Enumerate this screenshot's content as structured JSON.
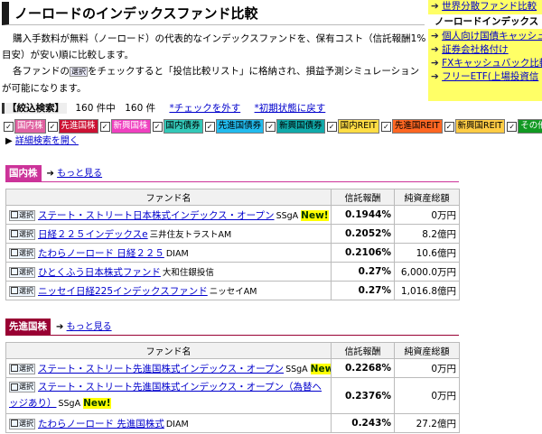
{
  "page": {
    "title": "ノーロードのインデックスファンド比較",
    "intro_line1": "購入手数料が無料（ノーロード）の代表的なインデックスファンドを、保有コスト（信託報酬1%目安）が安い順に比較します。",
    "intro_line2a": "各ファンドの",
    "intro_chk": "選択",
    "intro_line2b": "をチェックすると「投信比較リスト」に格納され、損益予測シミュレーションが可能になります。"
  },
  "sidebar": {
    "items": [
      {
        "label": "世界分散ファンド比較"
      },
      {
        "label": "ノーロードインデックス"
      },
      {
        "label": "個人向け国債キャッシュ"
      },
      {
        "label": "証券会社格付け"
      },
      {
        "label": "FXキャッシュバック比較"
      },
      {
        "label": "フリーETF(上場投資信"
      }
    ]
  },
  "filter": {
    "label": "【絞込検索】",
    "count": "160 件中　160 件",
    "uncheck": "*チェックを外す",
    "reset": "*初期状態に戻す",
    "detail": "詳細検索を開く",
    "tags": [
      {
        "label": "国内株",
        "bg": "#e060a0",
        "fg": "#ffffff"
      },
      {
        "label": "先進国株",
        "bg": "#cc1133",
        "fg": "#ffffff"
      },
      {
        "label": "新興国株",
        "bg": "#f040c0",
        "fg": "#ffffff"
      },
      {
        "label": "国内債券",
        "bg": "#33c8b8",
        "fg": "#000000"
      },
      {
        "label": "先進国債券",
        "bg": "#22bbee",
        "fg": "#000000"
      },
      {
        "label": "新興国債券",
        "bg": "#11aaaa",
        "fg": "#000000"
      },
      {
        "label": "国内REIT",
        "bg": "#ffdd44",
        "fg": "#000000"
      },
      {
        "label": "先進国REIT",
        "bg": "#ff6622",
        "fg": "#000000"
      },
      {
        "label": "新興国REIT",
        "bg": "#ffcc44",
        "fg": "#000000"
      },
      {
        "label": "その他",
        "bg": "#119922",
        "fg": "#ffffff"
      }
    ]
  },
  "table_headers": {
    "name": "ファンド名",
    "fee": "信託報酬",
    "net": "純資産総額"
  },
  "select_label": "選択",
  "new_label": "New!",
  "sections": [
    {
      "title": "国内株",
      "color": "#cc3399",
      "more": "もっと見る",
      "rows": [
        {
          "name": "ステート・ストリート日本株式インデックス・オープン",
          "company": "SSgA",
          "new": true,
          "fee": "0.1944%",
          "net": "0万円"
        },
        {
          "name": "日経２２５インデックスe",
          "company": "三井住友トラストAM",
          "new": false,
          "fee": "0.2052%",
          "net": "8.2億円"
        },
        {
          "name": "たわらノーロード 日経２２５",
          "company": "DIAM",
          "new": false,
          "fee": "0.2106%",
          "net": "10.6億円"
        },
        {
          "name": "ひとくふう日本株式ファンド",
          "company": "大和住銀投信",
          "new": false,
          "fee": "0.27%",
          "net": "6,000.0万円"
        },
        {
          "name": "ニッセイ日経225インデックスファンド",
          "company": "ニッセイAM",
          "new": false,
          "fee": "0.27%",
          "net": "1,016.8億円"
        }
      ]
    },
    {
      "title": "先進国株",
      "color": "#990033",
      "more": "もっと見る",
      "rows": [
        {
          "name": "ステート・ストリート先進国株式インデックス・オープン",
          "company": "SSgA",
          "new": true,
          "fee": "0.2268%",
          "net": "0万円"
        },
        {
          "name": "ステート・ストリート先進国株式インデックス・オープン（為替ヘッジあり）",
          "company": "SSgA",
          "new": true,
          "fee": "0.2376%",
          "net": "0万円"
        },
        {
          "name": "たわらノーロード 先進国株式",
          "company": "DIAM",
          "new": false,
          "fee": "0.243%",
          "net": "27.2億円"
        }
      ]
    }
  ]
}
